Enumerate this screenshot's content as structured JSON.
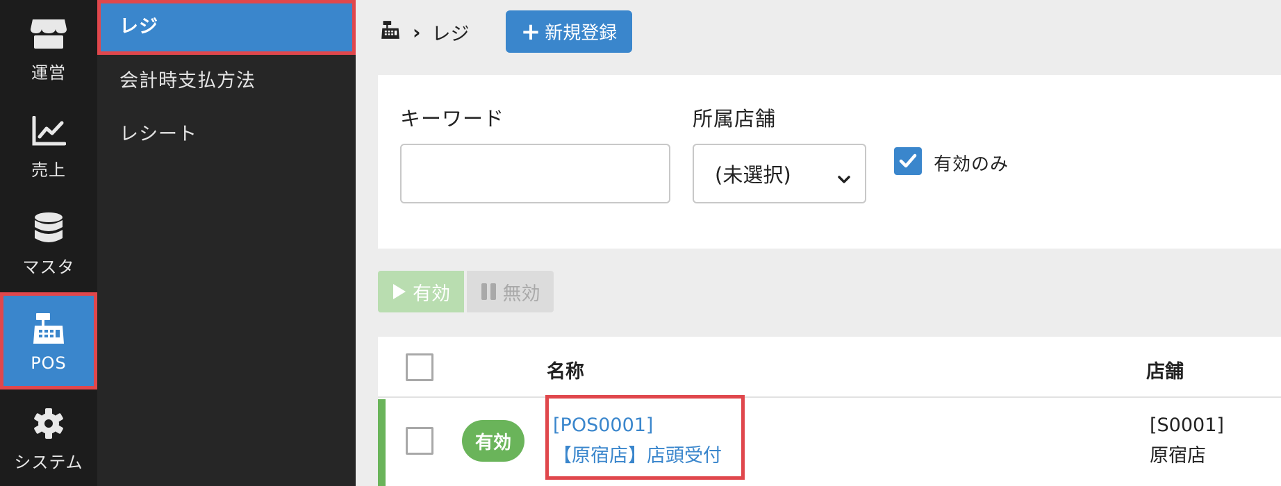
{
  "rail": {
    "items": [
      {
        "label": "運営",
        "icon": "store-icon"
      },
      {
        "label": "売上",
        "icon": "chart-line-icon"
      },
      {
        "label": "マスタ",
        "icon": "database-icon"
      },
      {
        "label": "POS",
        "icon": "cash-register-icon"
      },
      {
        "label": "システム",
        "icon": "gear-icon"
      }
    ],
    "active": "POS"
  },
  "subnav": {
    "items": [
      {
        "label": "レジ"
      },
      {
        "label": "会計時支払方法"
      },
      {
        "label": "レシート"
      }
    ],
    "active": "レジ"
  },
  "header": {
    "breadcrumb_icon": "cash-register-icon",
    "breadcrumb_current": "レジ",
    "new_button_label": "新規登録"
  },
  "filter": {
    "keyword_label": "キーワード",
    "keyword_value": "",
    "store_label": "所属店舗",
    "store_selected": "(未選択)",
    "active_only_label": "有効のみ",
    "active_only_checked": true
  },
  "actions": {
    "enable_label": "有効",
    "disable_label": "無効"
  },
  "table": {
    "columns": {
      "name": "名称",
      "store": "店舗"
    },
    "rows": [
      {
        "status": "有効",
        "code": "[POS0001]",
        "name": "【原宿店】店頭受付",
        "store_code": "[S0001]",
        "store_name": "原宿店"
      }
    ]
  },
  "colors": {
    "accent": "#3a86cc",
    "highlight_border": "#e0474c",
    "status_active": "#6ab45a"
  }
}
